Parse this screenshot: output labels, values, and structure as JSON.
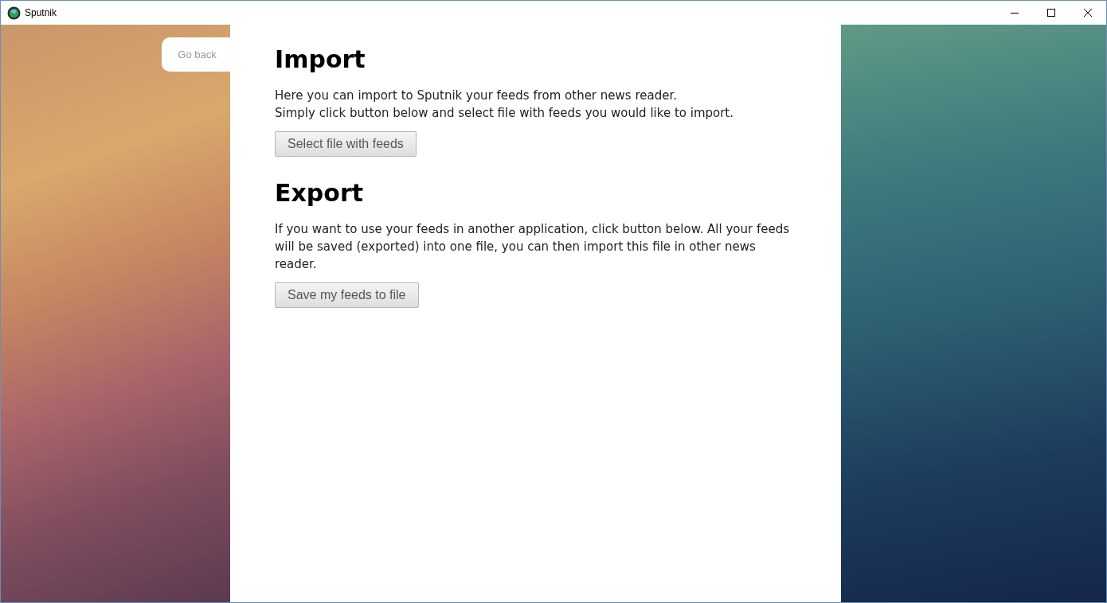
{
  "window": {
    "title": "Sputnik"
  },
  "go_back": "Go back",
  "sections": [
    {
      "heading": "Import",
      "lines": [
        "Here you can import to Sputnik your feeds from other news reader.",
        "Simply click button below and select file with feeds you would like to import."
      ],
      "button": "Select file with feeds"
    },
    {
      "heading": "Export",
      "lines": [
        "If you want to use your feeds in another application, click button below. All your feeds will be saved (exported) into one file, you can then import this file in other news reader."
      ],
      "button": "Save my feeds to file"
    }
  ]
}
